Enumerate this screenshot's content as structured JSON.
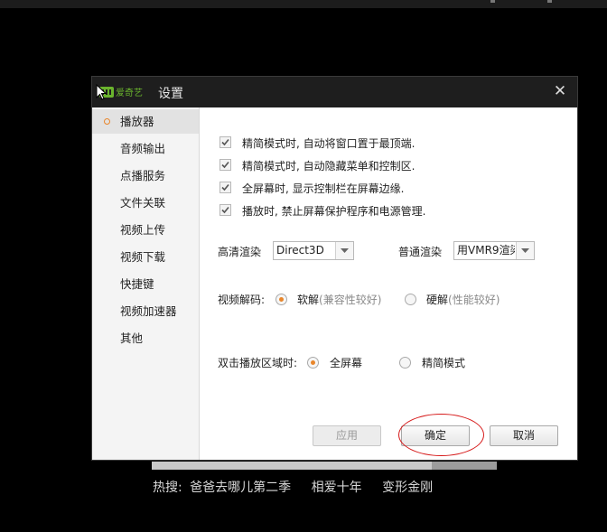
{
  "dialog": {
    "brand": "爱奇艺",
    "title": "设置",
    "close_glyph": "✕"
  },
  "sidebar": {
    "items": [
      {
        "label": "播放器",
        "active": true
      },
      {
        "label": "音频输出"
      },
      {
        "label": "点播服务"
      },
      {
        "label": "文件关联"
      },
      {
        "label": "视频上传"
      },
      {
        "label": "视频下载"
      },
      {
        "label": "快捷键"
      },
      {
        "label": "视频加速器"
      },
      {
        "label": "其他"
      }
    ]
  },
  "options": {
    "checkboxes": [
      {
        "label": "精简模式时, 自动将窗口置于最顶端.",
        "checked": true
      },
      {
        "label": "精简模式时, 自动隐藏菜单和控制区.",
        "checked": true
      },
      {
        "label": "全屏幕时, 显示控制栏在屏幕边缘.",
        "checked": true
      },
      {
        "label": "播放时, 禁止屏幕保护程序和电源管理.",
        "checked": true
      }
    ],
    "hd_render": {
      "label": "高清渲染",
      "value": "Direct3D"
    },
    "normal_render": {
      "label": "普通渲染",
      "value": "用VMR9渲染"
    },
    "decode": {
      "label": "视频解码:",
      "software": {
        "label": "软解",
        "hint": "(兼容性较好)",
        "selected": true
      },
      "hardware": {
        "label": "硬解",
        "hint": "(性能较好)",
        "selected": false
      }
    },
    "double_click": {
      "label": "双击播放区域时:",
      "fullscreen": {
        "label": "全屏幕",
        "selected": true
      },
      "compact": {
        "label": "精简模式",
        "selected": false
      }
    }
  },
  "buttons": {
    "apply": "应用",
    "ok": "确定",
    "cancel": "取消"
  },
  "hot_search": {
    "prefix": "热搜:",
    "items": [
      "爸爸去哪儿第二季",
      "相爱十年",
      "变形金刚"
    ]
  },
  "colors": {
    "accent": "#e8862b",
    "annotation": "#d61a1a",
    "brand_green": "#6ab42d"
  },
  "icons": [
    "logo-icon",
    "close-icon",
    "checkmark-icon",
    "dropdown-arrow-icon",
    "radio-icon",
    "cursor-icon"
  ]
}
